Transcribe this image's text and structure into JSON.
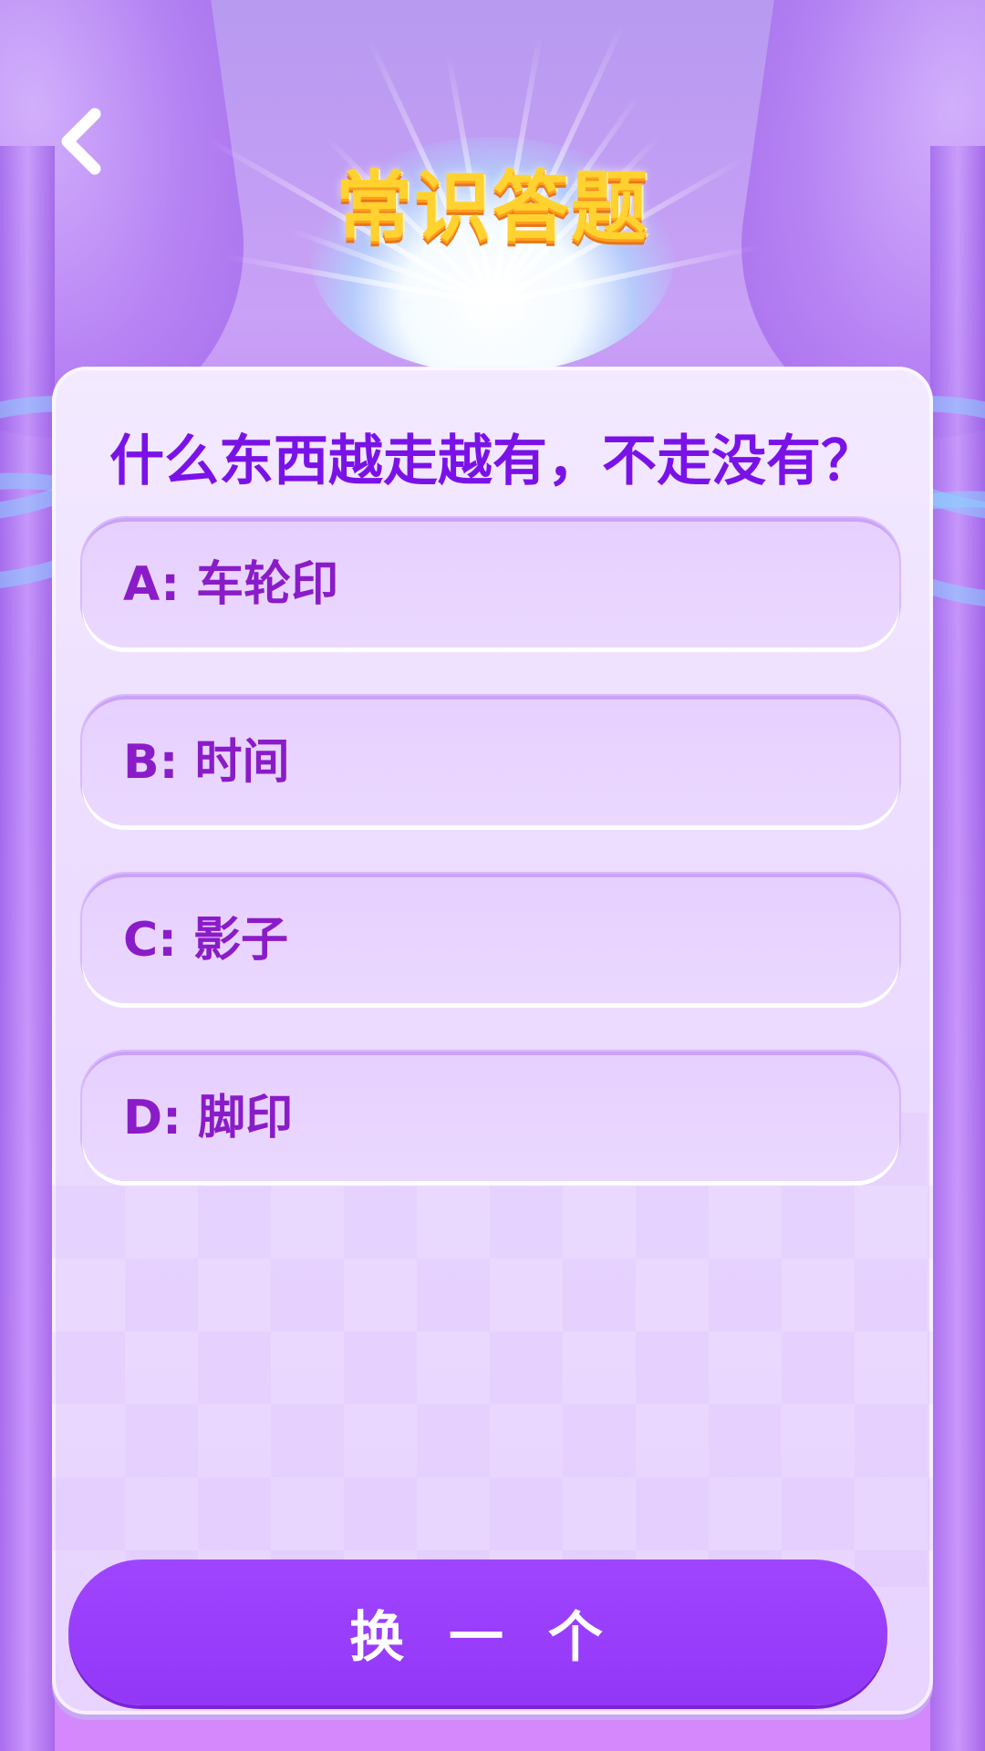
{
  "header": {
    "title": "常识答题",
    "back_icon": "chevron-left-icon"
  },
  "quiz": {
    "question": "什么东西越走越有，不走没有？",
    "options": [
      {
        "label": "A: 车轮印"
      },
      {
        "label": "B: 时间"
      },
      {
        "label": "C: 影子"
      },
      {
        "label": "D: 脚印"
      }
    ],
    "swap_button": "换 一 个"
  },
  "colors": {
    "accent": "#9b3ffd",
    "question_text": "#7a12e8",
    "option_text": "#8a1cc8",
    "title": "#ffd230",
    "card_bg": "#ecdcff"
  }
}
